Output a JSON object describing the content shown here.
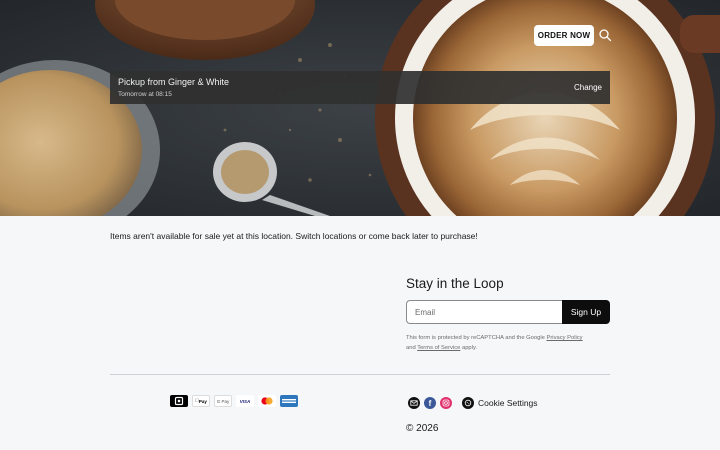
{
  "header": {
    "order_button": "ORDER NOW",
    "search_icon": "search-icon"
  },
  "pickup": {
    "title": "Pickup from Ginger & White",
    "time": "Tomorrow at 08:15",
    "change_label": "Change"
  },
  "notice": "Items aren't available for sale yet at this location. Switch locations or come back later to purchase!",
  "newsletter": {
    "title": "Stay in the Loop",
    "email_placeholder": "Email",
    "signup_label": "Sign Up",
    "legal_prefix": "This form is protected by reCAPTCHA and the Google",
    "privacy_label": "Privacy Policy",
    "legal_and": "and",
    "terms_label": "Terms of Service",
    "legal_suffix": "apply."
  },
  "payments": [
    {
      "name": "square-icon",
      "label": ""
    },
    {
      "name": "apple-pay-icon",
      "label": "Pay"
    },
    {
      "name": "google-pay-icon",
      "label": "G Pay"
    },
    {
      "name": "visa-icon",
      "label": "VISA"
    },
    {
      "name": "mastercard-icon",
      "label": ""
    },
    {
      "name": "amex-icon",
      "label": ""
    }
  ],
  "social": [
    "email-icon",
    "facebook-icon",
    "instagram-icon"
  ],
  "footer": {
    "cookie_label": "Cookie Settings",
    "copyright": "© 2026"
  },
  "colors": {
    "page_bg": "#f6f7f9",
    "pickup_bar": "#303030",
    "signup_bg": "#0d0d0d",
    "facebook": "#3b5998",
    "instagram": "#e1306c"
  }
}
